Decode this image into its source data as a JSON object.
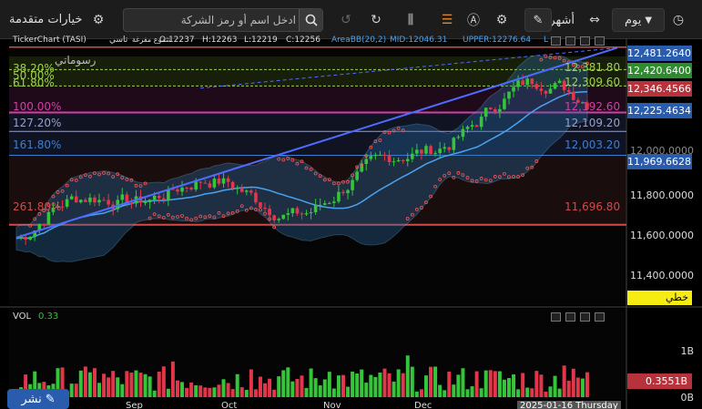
{
  "toolbar": {
    "range_label": "يوم",
    "interval_label": "6 أشهر",
    "search_placeholder": "ادخل اسم أو رمز الشركة",
    "advanced_label": "خيارات متقدمة"
  },
  "chart_header": {
    "symbol": "TickerChart (TASI)",
    "arabic_name": "تاسي",
    "chart_type_label": "شموع مفرغة",
    "open": "O:12237",
    "high": "H:12263",
    "low": "L:12219",
    "close": "C:12256",
    "indicator": "AreaBB(20,2)",
    "mid": "MID:12046.31",
    "upper": "UPPER:12276.64",
    "lower": "L",
    "watermark": "رسوماتي"
  },
  "fib_levels": [
    {
      "label": "38.20%",
      "color": "#9fd14a"
    },
    {
      "label": "50.00%",
      "color": "#9fd14a"
    },
    {
      "label": "61.80%",
      "color": "#9fd14a"
    },
    {
      "label": "100.00%",
      "color": "#d23fa8"
    },
    {
      "label": "127.20%",
      "color": "#9aa0c8"
    },
    {
      "label": "161.80%",
      "color": "#3f7fd1"
    },
    {
      "label": "261.80%",
      "color": "#d34a4a"
    }
  ],
  "fib_values": [
    {
      "label": "12,381.80",
      "color": "#9fd14a"
    },
    {
      "label": "12,309.60",
      "color": "#9fd14a"
    },
    {
      "label": "12,192.60",
      "color": "#d23fa8"
    },
    {
      "label": "12,109.20",
      "color": "#9aa0c8"
    },
    {
      "label": "12,003.20",
      "color": "#3f7fd1"
    },
    {
      "label": "11,696.80",
      "color": "#d34a4a"
    }
  ],
  "price_labels": [
    {
      "label": "12,481.2640",
      "color": "#2a5cae"
    },
    {
      "label": "12,420.6400",
      "color": "#2e8c2e"
    },
    {
      "label": "12,346.4566",
      "color": "#b8323c"
    },
    {
      "label": "12,225.4634",
      "color": "#2a5cae"
    },
    {
      "label": "11,969.6628",
      "color": "#2a5cae"
    }
  ],
  "line_style_label": "خطي",
  "vol_panel": {
    "title": "VOL",
    "value": "0.33",
    "last_label": "0.3551B",
    "axis_ticks": [
      "1B",
      "0B"
    ]
  },
  "x_axis_labels": [
    "Sep",
    "Oct",
    "Nov",
    "Dec"
  ],
  "crosshair_date": "2025-01-16 Thursday",
  "publish_label": "نشر",
  "chart_data": {
    "type": "candlestick",
    "y_ticks": [
      "12,000.0000",
      "11,800.0000",
      "11,600.0000",
      "11,400.0000"
    ],
    "ylim": [
      11350,
      12500
    ],
    "fib_price_levels": [
      12381.8,
      12309.6,
      12192.6,
      12109.2,
      12003.2,
      11696.8
    ],
    "volume_ylim": [
      0,
      1.5
    ]
  }
}
